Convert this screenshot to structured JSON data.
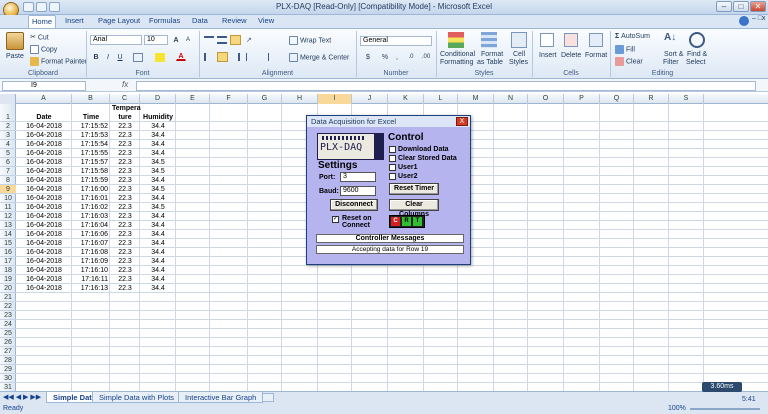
{
  "window": {
    "title": "PLX-DAQ  [Read-Only]  [Compatibility Mode] - Microsoft Excel",
    "min": "–",
    "max": "□",
    "close": "✕",
    "sub_close": "x"
  },
  "tabs": [
    "Home",
    "Insert",
    "Page Layout",
    "Formulas",
    "Data",
    "Review",
    "View"
  ],
  "ribbon": {
    "clipboard": {
      "paste": "Paste",
      "cut": "Cut",
      "copy": "Copy",
      "format_painter": "Format Painter",
      "label": "Clipboard"
    },
    "font": {
      "name": "Arial",
      "size": "10",
      "grow": "A",
      "shrink": "A",
      "bold": "B",
      "italic": "I",
      "underline": "U",
      "font_color": "A",
      "label": "Font"
    },
    "alignment": {
      "wrap": "Wrap Text",
      "merge": "Merge & Center",
      "label": "Alignment"
    },
    "number": {
      "format": "General",
      "currency": "$",
      "percent": "%",
      "comma": ",",
      "inc": ".0",
      "dec": ".00",
      "label": "Number"
    },
    "styles": {
      "conditional": "Conditional",
      "conditional2": "Formatting",
      "as_table": "Format",
      "as_table2": "as Table",
      "cell_styles": "Cell",
      "cell_styles2": "Styles",
      "label": "Styles"
    },
    "cells": {
      "insert": "Insert",
      "delete": "Delete",
      "format": "Format",
      "label": "Cells"
    },
    "editing": {
      "autosum": "AutoSum",
      "fill": "Fill",
      "clear": "Clear",
      "sort": "Sort &",
      "sort2": "Filter",
      "find": "Find &",
      "find2": "Select",
      "label": "Editing"
    }
  },
  "formula_bar": {
    "name_box": "I9",
    "fx": "fx",
    "value": ""
  },
  "columns": [
    "A",
    "B",
    "C",
    "D",
    "E",
    "F",
    "G",
    "H",
    "I",
    "J",
    "K",
    "L",
    "M",
    "N",
    "O",
    "P",
    "Q",
    "R",
    "S"
  ],
  "rows": [
    "1",
    "2",
    "3",
    "4",
    "5",
    "6",
    "7",
    "8",
    "9",
    "10",
    "11",
    "12",
    "13",
    "14",
    "15",
    "16",
    "17",
    "18",
    "19",
    "20",
    "21",
    "22",
    "23",
    "24",
    "25",
    "26",
    "27",
    "28",
    "29",
    "30",
    "31"
  ],
  "table": {
    "headers": {
      "date": "Date",
      "time": "Time",
      "temp1": "Tempera",
      "temp2": "ture",
      "humidity": "Humidity"
    },
    "data": [
      [
        "16-04-2018",
        "17:15:52",
        "22.3",
        "34.4"
      ],
      [
        "16-04-2018",
        "17:15:53",
        "22.3",
        "34.4"
      ],
      [
        "16-04-2018",
        "17:15:54",
        "22.3",
        "34.4"
      ],
      [
        "16-04-2018",
        "17:15:55",
        "22.3",
        "34.4"
      ],
      [
        "16-04-2018",
        "17:15:57",
        "22.3",
        "34.5"
      ],
      [
        "16-04-2018",
        "17:15:58",
        "22.3",
        "34.5"
      ],
      [
        "16-04-2018",
        "17:15:59",
        "22.3",
        "34.4"
      ],
      [
        "16-04-2018",
        "17:16:00",
        "22.3",
        "34.5"
      ],
      [
        "16-04-2018",
        "17:16:01",
        "22.3",
        "34.4"
      ],
      [
        "16-04-2018",
        "17:16:02",
        "22.3",
        "34.5"
      ],
      [
        "16-04-2018",
        "17:16:03",
        "22.3",
        "34.4"
      ],
      [
        "16-04-2018",
        "17:16:04",
        "22.3",
        "34.4"
      ],
      [
        "16-04-2018",
        "17:16:06",
        "22.3",
        "34.4"
      ],
      [
        "16-04-2018",
        "17:16:07",
        "22.3",
        "34.4"
      ],
      [
        "16-04-2018",
        "17:16:08",
        "22.3",
        "34.4"
      ],
      [
        "16-04-2018",
        "17:16:09",
        "22.3",
        "34.4"
      ],
      [
        "16-04-2018",
        "17:16:10",
        "22.3",
        "34.4"
      ],
      [
        "16-04-2018",
        "17:16:11",
        "22.3",
        "34.4"
      ],
      [
        "16-04-2018",
        "17:16:13",
        "22.3",
        "34.4"
      ]
    ]
  },
  "sheets": [
    "Simple Data",
    "Simple Data with Plots",
    "Interactive Bar Graph"
  ],
  "status": {
    "ready": "Ready",
    "zoom": "100%",
    "tray_speed": "3.60ms",
    "tray_time": "5:41"
  },
  "dialog": {
    "title": "Data Acquisition for Excel",
    "close": "X",
    "logo_text": "PLX-DAQ",
    "settings": "Settings",
    "port_label": "Port:",
    "port_value": "3",
    "baud_label": "Baud:",
    "baud_value": "9600",
    "disconnect": "Disconnect",
    "reset_on_connect_1": "Reset on",
    "reset_on_connect_2": "Connect",
    "control": "Control",
    "download_data": "Download Data",
    "clear_stored": "Clear Stored Data",
    "user1": "User1",
    "user2": "User2",
    "reset_timer": "Reset Timer",
    "clear_columns": "Clear Columns",
    "indicators": [
      "C",
      "R",
      "T"
    ],
    "messages_header": "Controller Messages",
    "message": "Accepting data for Row 19"
  }
}
